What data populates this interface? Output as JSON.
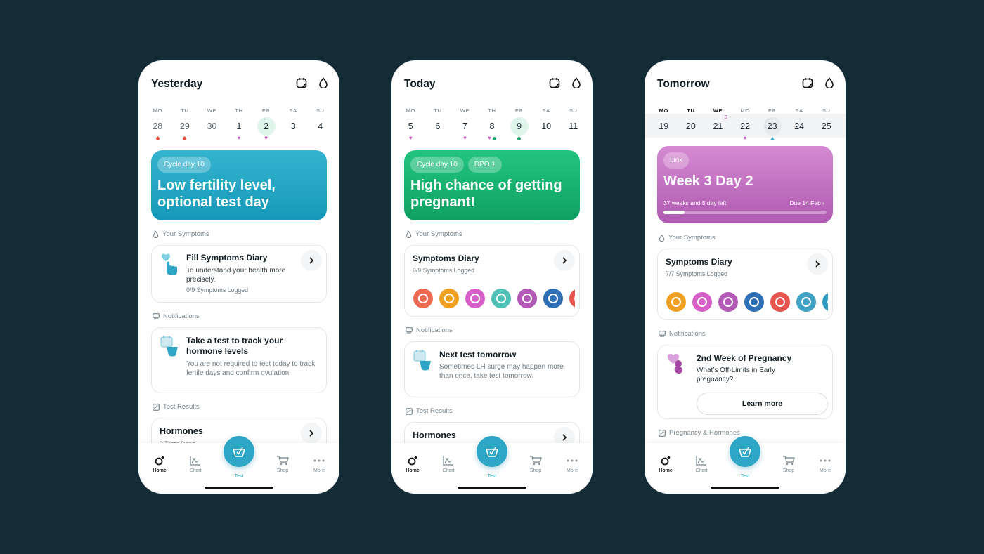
{
  "colors": {
    "background": "#132c36",
    "teal": "#1ea0bd",
    "green": "#14a86b",
    "pink": "#c174c3",
    "heart": "#c44fc0",
    "drop": "#e54d3d"
  },
  "screens": [
    {
      "title": "Yesterday",
      "icons": [
        "calendar-icon",
        "drop-icon"
      ],
      "week": [
        {
          "d": "MO",
          "n": "28",
          "mark": "drop"
        },
        {
          "d": "TU",
          "n": "29",
          "mark": "drop"
        },
        {
          "d": "WE",
          "n": "30"
        },
        {
          "d": "TH",
          "n": "1",
          "mark": "heart"
        },
        {
          "d": "FR",
          "n": "2",
          "mark": "heart",
          "selected": true
        },
        {
          "d": "SA",
          "n": "3"
        },
        {
          "d": "SU",
          "n": "4"
        }
      ],
      "banner": {
        "pills": [
          "Cycle day 10"
        ],
        "title": "Low fertility level, optional test day"
      },
      "symptoms": {
        "section": "Your Symptoms",
        "title": "Fill Symptoms Diary",
        "text": "To understand your health more precisely.",
        "sub": "0/9 Symptoms Logged"
      },
      "notifications": {
        "section": "Notifications",
        "title": "Take a test to track your hormone levels",
        "text": "You are not required to test today to track fertile days and confirm ovulation."
      },
      "results": {
        "section": "Test Results",
        "title": "Hormones",
        "sub": "3 Tests Done"
      }
    },
    {
      "title": "Today",
      "icons": [
        "calendar-icon",
        "drop-icon"
      ],
      "week": [
        {
          "d": "MO",
          "n": "5",
          "mark": "heart"
        },
        {
          "d": "TU",
          "n": "6"
        },
        {
          "d": "WE",
          "n": "7",
          "mark": "heart"
        },
        {
          "d": "TH",
          "n": "8",
          "mark": "heart-dot"
        },
        {
          "d": "FR",
          "n": "9",
          "mark": "dot",
          "selected": true
        },
        {
          "d": "SA",
          "n": "10"
        },
        {
          "d": "SU",
          "n": "11"
        }
      ],
      "banner": {
        "pills": [
          "Cycle day 10",
          "DPO 1"
        ],
        "title": "High chance of getting pregnant!"
      },
      "symptoms": {
        "section": "Your Symptoms",
        "title": "Symptoms Diary",
        "sub": "9/9 Symptoms Logged",
        "circles": [
          "#ef6a52",
          "#f0a020",
          "#d85fc8",
          "#4fc1b5",
          "#b35ab6",
          "#2f6fb5",
          "#e8544e",
          "#6cb2cf",
          "#cfe5ee"
        ]
      },
      "notifications": {
        "section": "Notifications",
        "title": "Next test tomorrow",
        "text": "Sometimes LH surge may happen more than once, take test tomorrow."
      },
      "results": {
        "section": "Test Results",
        "title": "Hormones"
      }
    },
    {
      "title": "Tomorrow",
      "icons": [
        "calendar-icon",
        "drop-icon"
      ],
      "week": [
        {
          "d": "MO",
          "n": "19"
        },
        {
          "d": "TU",
          "n": "20"
        },
        {
          "d": "WE",
          "n": "21",
          "sup": "3"
        },
        {
          "d": "MO",
          "n": "22",
          "mark": "heart"
        },
        {
          "d": "FR",
          "n": "23",
          "mark": "tri",
          "selected": true
        },
        {
          "d": "SA",
          "n": "24"
        },
        {
          "d": "SU",
          "n": "25"
        }
      ],
      "banner": {
        "pills": [
          "Link"
        ],
        "title": "Week 3 Day 2",
        "left": "37 weeks and 5 day left",
        "right": "Due 14 Feb ›",
        "progress": 0.13
      },
      "symptoms": {
        "section": "Your Symptoms",
        "title": "Symptoms Diary",
        "sub": "7/7 Symptoms Logged",
        "circles": [
          "#f0a020",
          "#d85fc8",
          "#b35ab6",
          "#2f6fb5",
          "#e8544e",
          "#3ea3c4",
          "#2c9cc0"
        ]
      },
      "notifications": {
        "section": "Notifications",
        "title": "2nd Week of Pregnancy",
        "text": "What’s Off-Limits in Early pregnancy?",
        "button": "Learn more"
      },
      "results": {
        "section": "Pregnancy & Hormones"
      }
    }
  ],
  "tabs": [
    "Home",
    "Chart",
    "Test",
    "Shop",
    "More"
  ]
}
